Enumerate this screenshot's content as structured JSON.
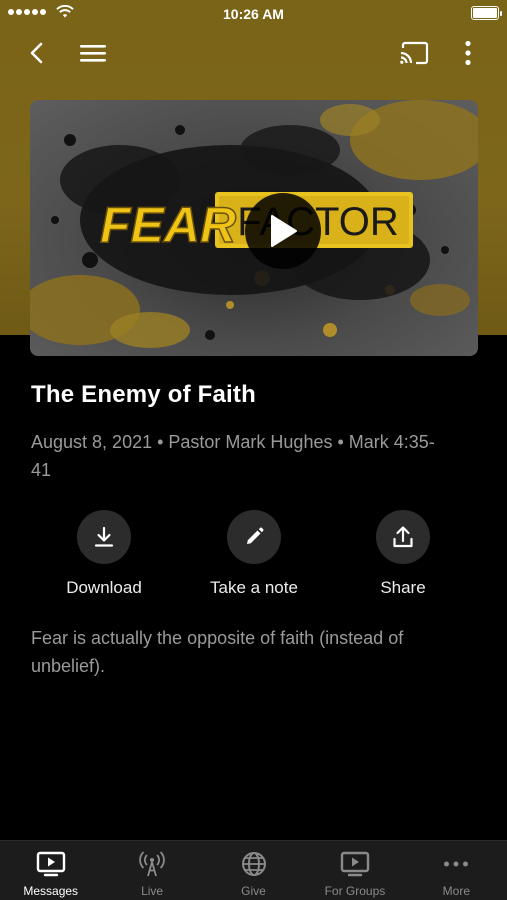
{
  "status_bar": {
    "time": "10:26 AM"
  },
  "header": {
    "accent_color": "#7a6418"
  },
  "hero": {
    "artwork_text_left": "FEAR",
    "artwork_text_right": "FACTOR"
  },
  "message": {
    "title": "The Enemy of Faith",
    "meta": "August 8, 2021 • Pastor Mark Hughes • Mark 4:35-41",
    "description": "Fear is actually the opposite of faith (instead of unbelief)."
  },
  "actions": [
    {
      "label": "Download",
      "icon": "download-icon"
    },
    {
      "label": "Take a note",
      "icon": "pencil-icon"
    },
    {
      "label": "Share",
      "icon": "share-icon"
    }
  ],
  "tabs": [
    {
      "label": "Messages",
      "icon": "tv-play-icon",
      "active": true
    },
    {
      "label": "Live",
      "icon": "broadcast-icon",
      "active": false
    },
    {
      "label": "Give",
      "icon": "globe-icon",
      "active": false
    },
    {
      "label": "For Groups",
      "icon": "tv-play-icon",
      "active": false
    },
    {
      "label": "More",
      "icon": "more-dots-icon",
      "active": false
    }
  ]
}
